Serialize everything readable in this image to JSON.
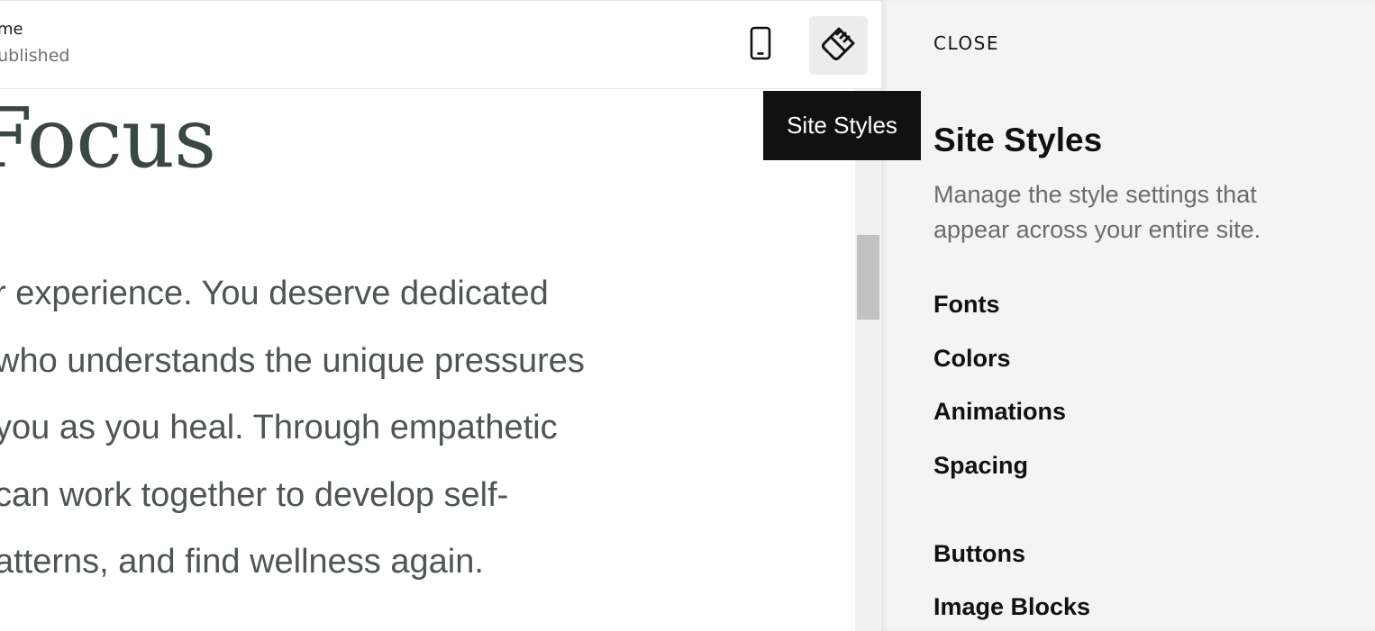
{
  "topbar": {
    "page_title": "ome",
    "page_status": "Published",
    "mobile_icon": "mobile-phone-icon",
    "styles_icon": "paintbrush-icon"
  },
  "tooltip": {
    "text": "Site Styles"
  },
  "preview": {
    "heading": "Focus",
    "lines": [
      "r experience. You deserve dedicated",
      "who understands the unique pressures",
      "you as you heal. Through empathetic",
      "can work together to develop self-",
      "atterns, and find wellness again."
    ]
  },
  "panel": {
    "close_label": "CLOSE",
    "title": "Site Styles",
    "description": "Manage the style settings that appear across your entire site.",
    "items": [
      {
        "label": "Fonts"
      },
      {
        "label": "Colors"
      },
      {
        "label": "Animations"
      },
      {
        "label": "Spacing"
      },
      {
        "label": "Buttons"
      },
      {
        "label": "Image Blocks"
      }
    ]
  },
  "colors": {
    "panel_bg": "#f4f4f4",
    "tooltip_bg": "#111111",
    "heading_text": "#3b4744",
    "active_button_bg": "#ececec"
  }
}
